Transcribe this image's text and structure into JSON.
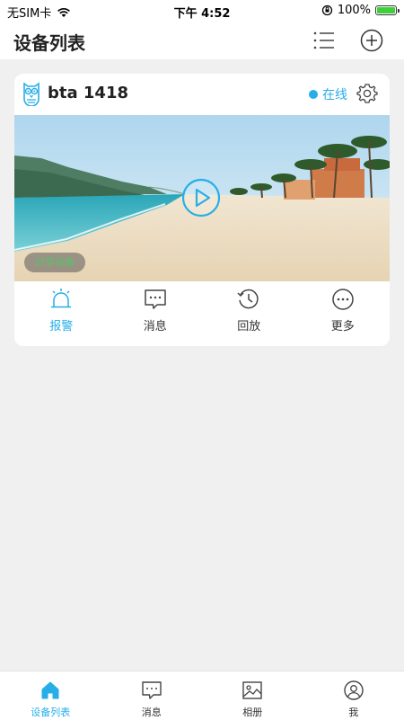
{
  "status_bar": {
    "carrier": "无SIM卡",
    "time": "下午 4:52",
    "battery": "100%",
    "battery_level": 1.0
  },
  "header": {
    "title": "设备列表"
  },
  "device": {
    "name": "bta 1418",
    "status": "在线",
    "status_color": "#27aee8",
    "share_tag": "分享设备",
    "actions": [
      {
        "label": "报警",
        "icon": "alarm-icon",
        "active": true
      },
      {
        "label": "消息",
        "icon": "message-icon",
        "active": false
      },
      {
        "label": "回放",
        "icon": "playback-icon",
        "active": false
      },
      {
        "label": "更多",
        "icon": "more-icon",
        "active": false
      }
    ]
  },
  "tabs": [
    {
      "label": "设备列表",
      "icon": "home-icon",
      "active": true
    },
    {
      "label": "消息",
      "icon": "message-icon",
      "active": false
    },
    {
      "label": "相册",
      "icon": "album-icon",
      "active": false
    },
    {
      "label": "我",
      "icon": "profile-icon",
      "active": false
    }
  ],
  "colors": {
    "accent": "#27aee8",
    "background": "#f0f0f0",
    "share_text": "#59c26a"
  }
}
